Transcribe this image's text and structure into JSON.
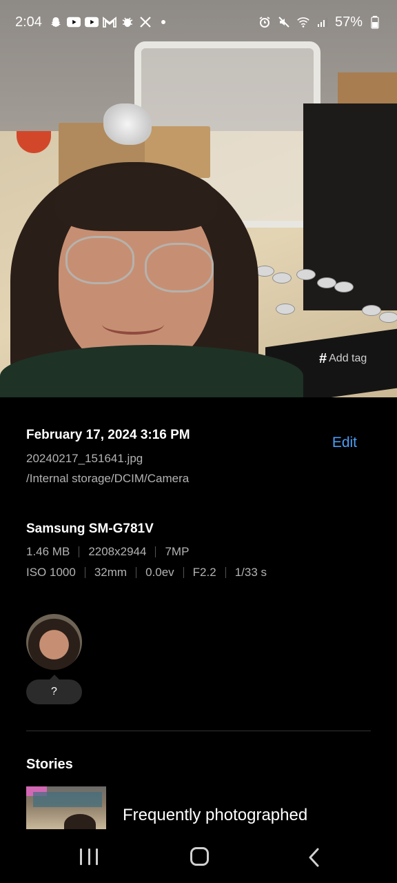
{
  "status_bar": {
    "time": "2:04",
    "notification_icons": [
      "snapchat-icon",
      "youtube-icon",
      "youtube-icon",
      "gmail-icon",
      "bug-icon",
      "x-icon",
      "dot-icon"
    ],
    "system_icons": [
      "alarm-icon",
      "mute-icon",
      "wifi-icon",
      "signal-icon"
    ],
    "battery": "57%"
  },
  "photo": {
    "add_tag_symbol": "#",
    "add_tag_label": "Add tag"
  },
  "details": {
    "date": "February 17, 2024 3:16 PM",
    "edit_label": "Edit",
    "filename": "20240217_151641.jpg",
    "path": "/Internal storage/DCIM/Camera"
  },
  "device": {
    "name": "Samsung SM-G781V",
    "row1": [
      "1.46 MB",
      "2208x2944",
      "7MP"
    ],
    "row2": [
      "ISO 1000",
      "32mm",
      "0.0ev",
      "F2.2",
      "1/33 s"
    ]
  },
  "people": {
    "unknown_label": "?"
  },
  "stories": {
    "title": "Stories",
    "item_label": "Frequently photographed"
  },
  "accent_color": "#4d9df5"
}
